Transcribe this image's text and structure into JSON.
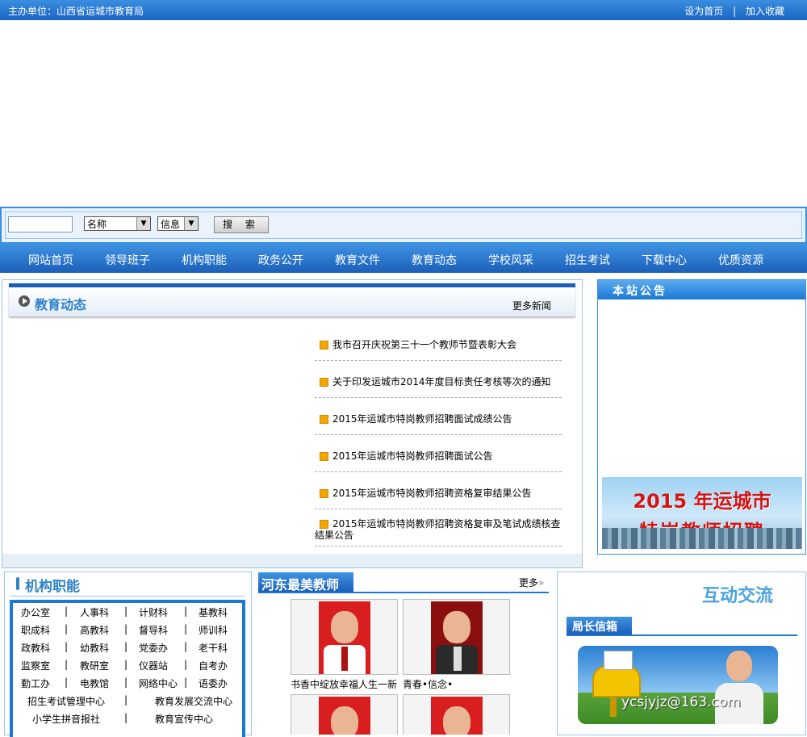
{
  "topbar": {
    "host": "主办单位：山西省运城市教育局",
    "set_home": "设为首页",
    "divider": "|",
    "favorite": "加入收藏"
  },
  "search": {
    "select_type": "名称",
    "select_scope": "信息",
    "button": "搜 索"
  },
  "nav": [
    "网站首页",
    "领导班子",
    "机构职能",
    "政务公开",
    "教育文件",
    "教育动态",
    "学校风采",
    "招生考试",
    "下载中心",
    "优质资源"
  ],
  "news": {
    "title": "教育动态",
    "more": "更多新闻",
    "items": [
      "我市召开庆祝第三十一个教师节暨表彰大会",
      "关于印发运城市2014年度目标责任考核等次的通知",
      "2015年运城市特岗教师招聘面试成绩公告",
      "2015年运城市特岗教师招聘面试公告",
      "2015年运城市特岗教师招聘资格复审结果公告",
      "2015年运城市特岗教师招聘资格复审及笔试成绩核查结果公告"
    ]
  },
  "notice": {
    "title": "本站公告",
    "banner_line1": "2015 年运城市",
    "banner_line2": "特岗教师招聘"
  },
  "org": {
    "title": "机构职能",
    "rows": [
      [
        "办公室",
        "人事科",
        "计财科",
        "基教科"
      ],
      [
        "职成科",
        "高教科",
        "督导科",
        "师训科"
      ],
      [
        "政教科",
        "幼教科",
        "党委办",
        "老干科"
      ],
      [
        "监察室",
        "教研室",
        "仪器站",
        "自考办"
      ],
      [
        "勤工办",
        "电教馆",
        "网络中心",
        "语委办"
      ]
    ],
    "rows2": [
      [
        "招生考试管理中心",
        "教育发展交流中心"
      ],
      [
        "小学生拼音报社",
        "教育宣传中心"
      ]
    ],
    "sep": "|"
  },
  "teachers": {
    "title": "河东最美教师",
    "more": "更多",
    "captions": [
      "书香中绽放幸福人生一新",
      "青春•信念•"
    ],
    "colors": {
      "red_bg": "#d81e1e",
      "dark_red_bg": "#8b0f0f"
    }
  },
  "interact": {
    "title": "互动交流",
    "mailbox": "局长信箱",
    "email": "ycsjyjz@163.com"
  }
}
